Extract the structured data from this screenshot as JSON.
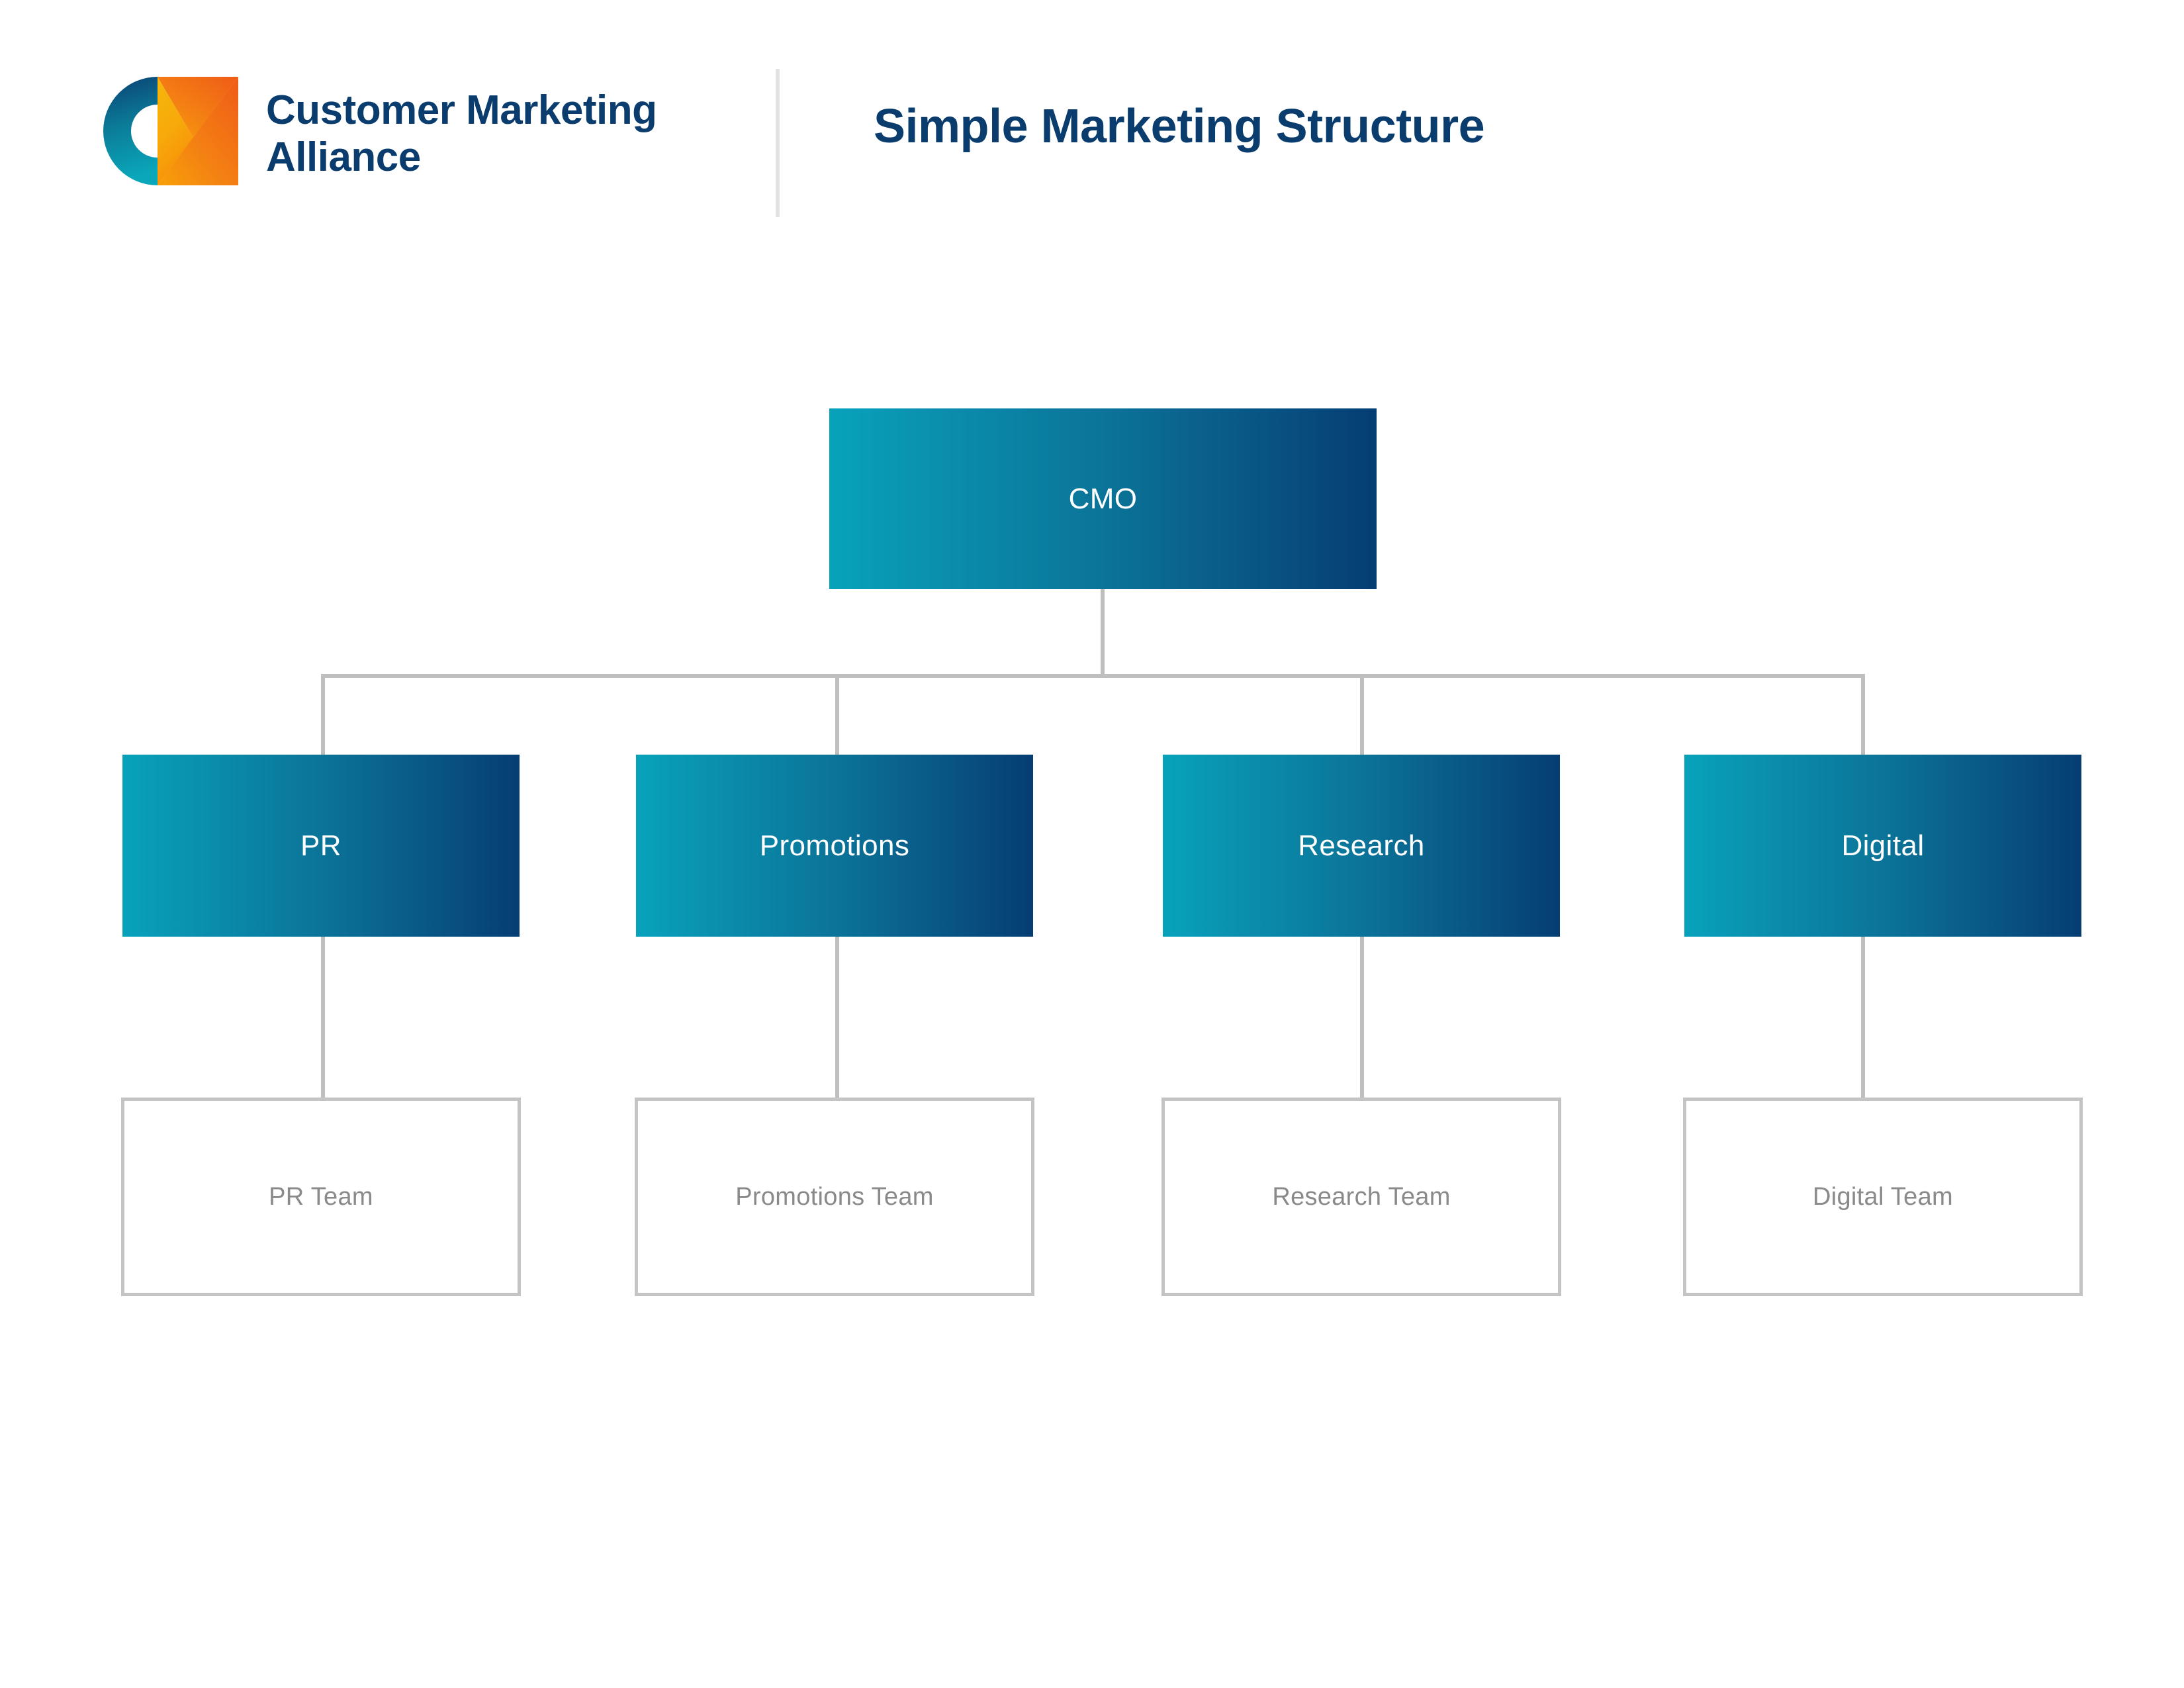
{
  "brand": {
    "name": "Customer Marketing\nAlliance",
    "logo_icon": "cma-logo-mark",
    "text_color": "#0a3d6e"
  },
  "header": {
    "title": "Simple Marketing Structure",
    "title_color": "#0a3d6e",
    "divider_color": "#e2e2e2"
  },
  "theme": {
    "node_gradient_start": "#07a3bb",
    "node_gradient_end": "#063d73",
    "connector_color": "#bfbfbf",
    "leaf_border_color": "#c4c4c4",
    "leaf_text_color": "#8a8a8a",
    "node_text_color": "#ffffff",
    "background": "#ffffff"
  },
  "chart_data": {
    "type": "diagram",
    "subtype": "org-chart",
    "title": "Simple Marketing Structure",
    "orientation": "top-down",
    "levels": 3,
    "root": {
      "id": "cmo",
      "label": "CMO"
    },
    "departments": [
      {
        "id": "pr",
        "label": "PR",
        "team": "PR Team"
      },
      {
        "id": "promotions",
        "label": "Promotions",
        "team": "Promotions Team"
      },
      {
        "id": "research",
        "label": "Research",
        "team": "Research Team"
      },
      {
        "id": "digital",
        "label": "Digital",
        "team": "Digital Team"
      }
    ],
    "edges": [
      {
        "from": "cmo",
        "to": "pr"
      },
      {
        "from": "cmo",
        "to": "promotions"
      },
      {
        "from": "cmo",
        "to": "research"
      },
      {
        "from": "cmo",
        "to": "digital"
      },
      {
        "from": "pr",
        "to": "pr-team"
      },
      {
        "from": "promotions",
        "to": "promotions-team"
      },
      {
        "from": "research",
        "to": "research-team"
      },
      {
        "from": "digital",
        "to": "digital-team"
      }
    ]
  },
  "nodes": {
    "root": {
      "label": "CMO"
    },
    "level2": [
      {
        "label": "PR"
      },
      {
        "label": "Promotions"
      },
      {
        "label": "Research"
      },
      {
        "label": "Digital"
      }
    ],
    "level3": [
      {
        "label": "PR Team"
      },
      {
        "label": "Promotions Team"
      },
      {
        "label": "Research Team"
      },
      {
        "label": "Digital Team"
      }
    ]
  }
}
